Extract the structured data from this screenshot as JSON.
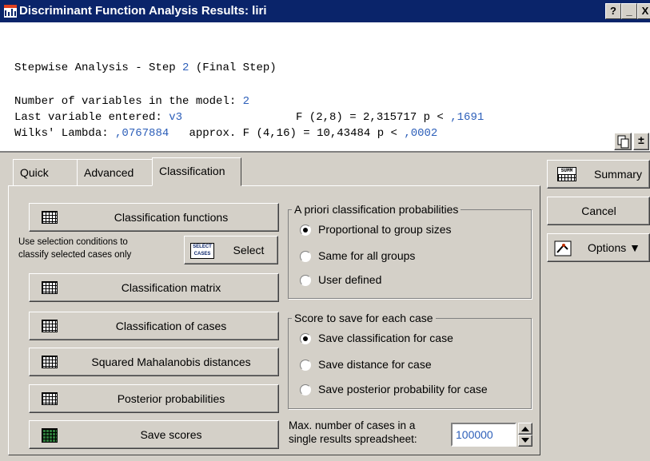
{
  "window": {
    "title": "Discriminant Function Analysis Results: liri",
    "help_label": "?",
    "minimize_label": "_",
    "close_label": "X"
  },
  "output": {
    "line1_prefix": "Stepwise Analysis - Step ",
    "line1_step": "2",
    "line1_suffix": " (Final Step)",
    "line2_label": "Number of variables in the model: ",
    "line2_value": "2",
    "line3_label": "Last variable entered: ",
    "line3_var": "v3",
    "line3_f": "F (2,8) = 2,315717 p < ",
    "line3_p": ",1691",
    "line4_label": "Wilks' Lambda: ",
    "line4_lambda": ",0767884",
    "line4_f": "   approx. F (4,16) = 10,43484 p < ",
    "line4_p": ",0002"
  },
  "tabs": [
    "Quick",
    "Advanced",
    "Classification"
  ],
  "active_tab": "Classification",
  "buttons": {
    "classification_functions": "Classification functions",
    "classification_matrix": "Classification matrix",
    "classification_of_cases": "Classification of cases",
    "mahalanobis": "Squared Mahalanobis distances",
    "posterior": "Posterior probabilities",
    "save_scores": "Save scores",
    "select": "Select",
    "select_icon_text": [
      "SELECT",
      "CASES"
    ]
  },
  "select_note": [
    "Use selection conditions to",
    "classify selected cases only"
  ],
  "priori": {
    "title": "A priori classification probabilities",
    "options": [
      "Proportional to group sizes",
      "Same for all groups",
      "User defined"
    ],
    "selected": 0
  },
  "score": {
    "title": "Score to save for each case",
    "options": [
      "Save classification for case",
      "Save distance for case",
      "Save posterior probability for case"
    ],
    "selected": 0
  },
  "max_cases": {
    "label": [
      "Max. number of cases in a",
      "single results spreadsheet:"
    ],
    "value": "100000"
  },
  "side": {
    "summary": "Summary",
    "summary_icon_text": "SUMM",
    "cancel": "Cancel",
    "options": "Options ▼"
  },
  "colors": {
    "titlebar": "#0a246a",
    "face": "#d4d0c8",
    "output_accent": "#2d5fb9"
  }
}
